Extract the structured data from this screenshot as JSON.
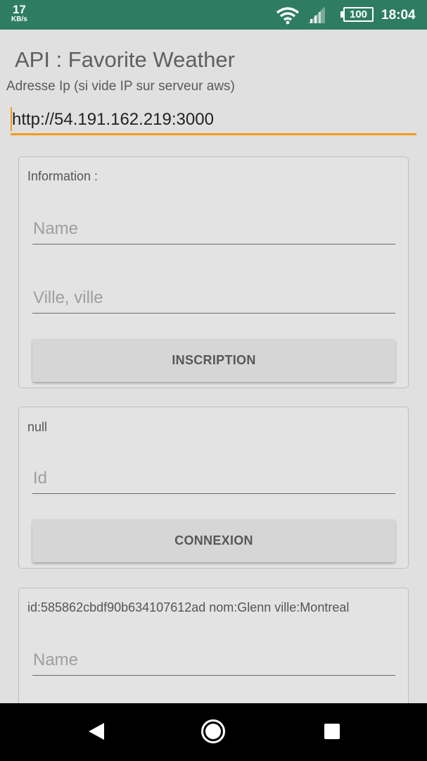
{
  "status_bar": {
    "net_speed_value": "17",
    "net_speed_unit": "KB/s",
    "battery": "100",
    "time": "18:04"
  },
  "app": {
    "title": "API : Favorite Weather",
    "ip_label": "Adresse Ip (si vide IP sur serveur aws)",
    "ip_value": "http://54.191.162.219:3000"
  },
  "register_card": {
    "title": "Information :",
    "name_placeholder": "Name",
    "city_placeholder": "Ville, ville",
    "button_label": "INSCRIPTION"
  },
  "login_card": {
    "title": "null",
    "id_placeholder": "Id",
    "button_label": "CONNEXION"
  },
  "profile_card": {
    "title": "id:585862cbdf90b634107612ad nom:Glenn ville:Montreal",
    "name_placeholder": "Name"
  },
  "colors": {
    "status_bar": "#2e7d62",
    "accent": "#f29c1f",
    "background": "#e0e0e0"
  },
  "icons": {
    "wifi": "wifi-icon",
    "signal": "signal-icon",
    "battery": "battery-icon",
    "back": "back-icon",
    "home": "home-icon",
    "recents": "recents-icon"
  }
}
